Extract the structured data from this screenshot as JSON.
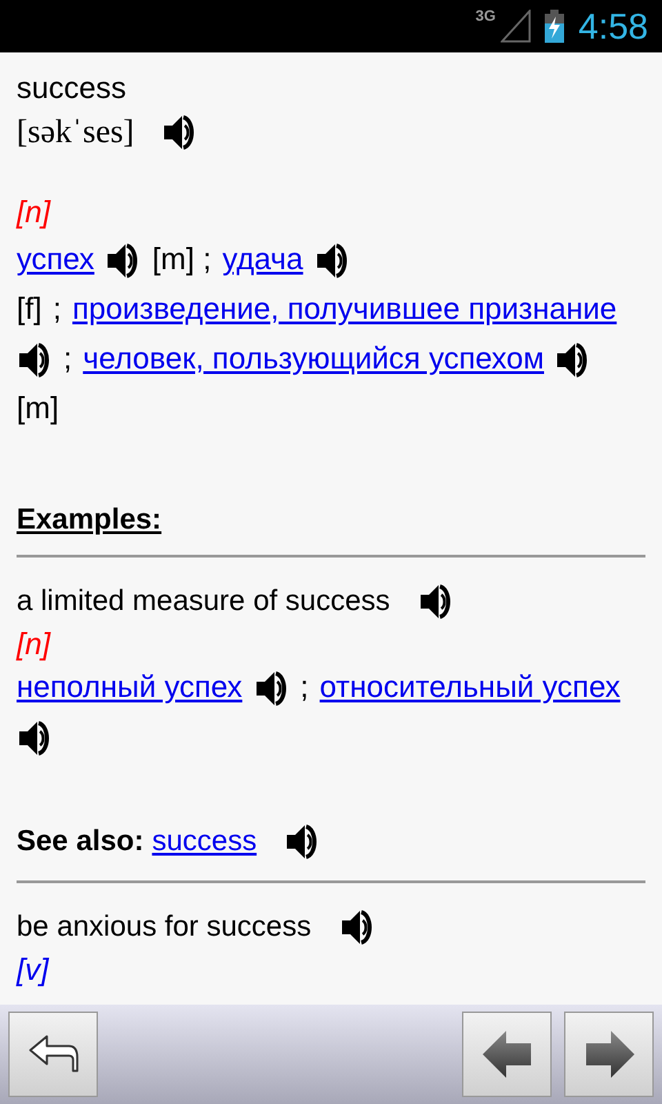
{
  "status_bar": {
    "network": "3G",
    "time": "4:58"
  },
  "entry": {
    "headword": "success",
    "transcription": "[səkˈses]"
  },
  "senses": [
    {
      "pos": "[n]",
      "color": "#ff0000",
      "tokens": [
        {
          "kind": "link",
          "text": "успех"
        },
        {
          "kind": "sound"
        },
        {
          "kind": "text",
          "text": "[m] ;"
        },
        {
          "kind": "link",
          "text": "удача"
        },
        {
          "kind": "sound"
        },
        {
          "kind": "text",
          "text": "[f]"
        },
        {
          "kind": "text",
          "text": ";"
        },
        {
          "kind": "link",
          "text": "произведение, получившее признание"
        },
        {
          "kind": "sound"
        },
        {
          "kind": "text",
          "text": ";"
        },
        {
          "kind": "link",
          "text": "человек, пользующийся успехом"
        },
        {
          "kind": "sound"
        },
        {
          "kind": "text",
          "text": "[m]"
        }
      ]
    }
  ],
  "examples_heading": "Examples:",
  "examples": [
    {
      "phrase": "a limited measure of success",
      "pos": "[n]",
      "color": "#ff0000",
      "tokens": [
        {
          "kind": "link",
          "text": "неполный успех"
        },
        {
          "kind": "sound"
        },
        {
          "kind": "text",
          "text": ";"
        },
        {
          "kind": "link",
          "text": "относительный успех"
        },
        {
          "kind": "sound"
        }
      ]
    }
  ],
  "see_also": {
    "label": "See also:",
    "link": "success"
  },
  "more": [
    {
      "phrase": "be anxious for success",
      "pos": "[v]",
      "color": "#0000ee"
    }
  ],
  "toolbar": [
    {
      "kind": "back"
    },
    {
      "kind": "prev"
    },
    {
      "kind": "next"
    }
  ]
}
